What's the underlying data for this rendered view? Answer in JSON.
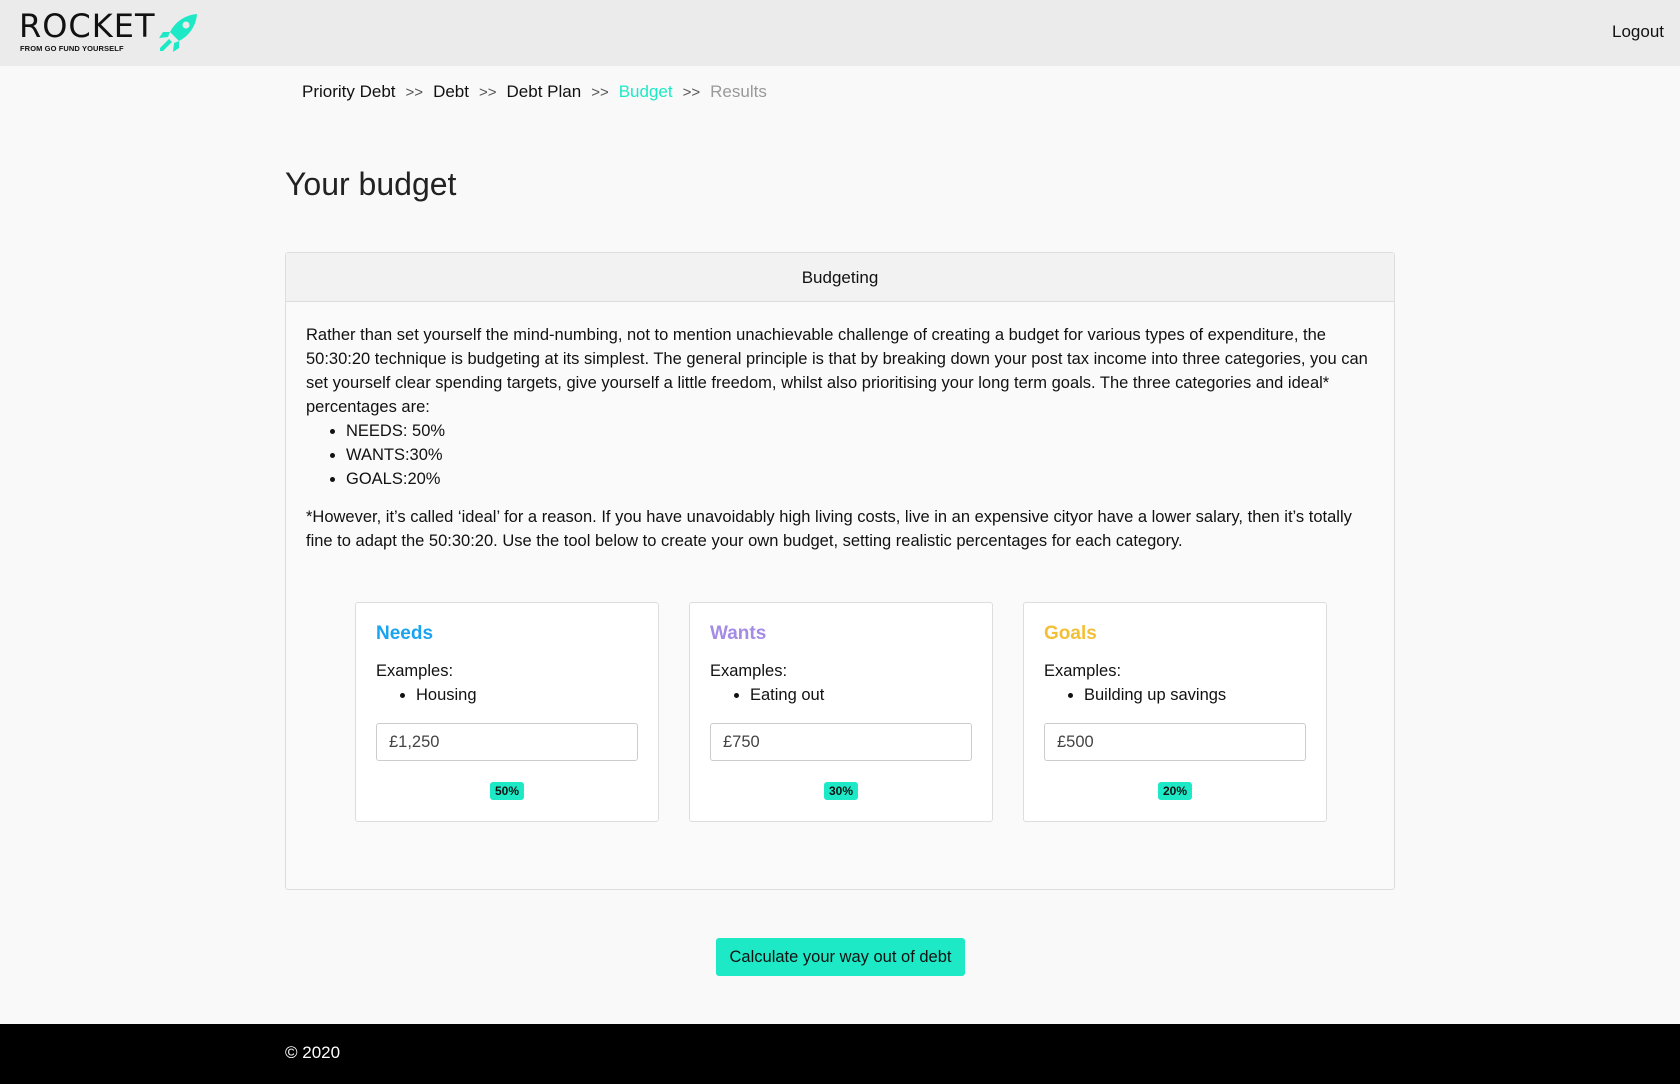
{
  "header": {
    "logo_text": "ROCKET",
    "logo_tagline": "FROM GO FUND YOURSELF",
    "logout_label": "Logout"
  },
  "breadcrumb": {
    "items": [
      {
        "label": "Priority Debt",
        "state": "default"
      },
      {
        "label": "Debt",
        "state": "default"
      },
      {
        "label": "Debt Plan",
        "state": "default"
      },
      {
        "label": "Budget",
        "state": "active"
      },
      {
        "label": "Results",
        "state": "disabled"
      }
    ],
    "separator": ">>"
  },
  "page": {
    "title": "Your budget"
  },
  "budget_card": {
    "header": "Budgeting",
    "intro": "Rather than set yourself the mind-numbing, not to mention unachievable challenge of creating a budget for various types of expenditure, the 50:30:20 technique is budgeting at its simplest. The general principle is that by breaking down your post tax income into three categories, you can set yourself clear spending targets, give yourself a little freedom, whilst also prioritising your long term goals. The three categories and ideal* percentages are:",
    "ideal_list": [
      "NEEDS: 50%",
      "WANTS:30%",
      "GOALS:20%"
    ],
    "note": "*However, it’s called ‘ideal’ for a reason. If you have unavoidably high living costs, live in an expensive cityor have a lower salary, then it’s totally fine to adapt the 50:30:20. Use the tool below to create your own budget, setting realistic percentages for each category."
  },
  "categories": [
    {
      "title": "Needs",
      "examples_label": "Examples:",
      "example": "Housing",
      "value": "£1,250",
      "percent": "50%",
      "color": "#1aa3f0"
    },
    {
      "title": "Wants",
      "examples_label": "Examples:",
      "example": "Eating out",
      "value": "£750",
      "percent": "30%",
      "color": "#a48be6"
    },
    {
      "title": "Goals",
      "examples_label": "Examples:",
      "example": "Building up savings",
      "value": "£500",
      "percent": "20%",
      "color": "#f2c037"
    }
  ],
  "actions": {
    "calculate_label": "Calculate your way out of debt"
  },
  "footer": {
    "copyright": "© 2020"
  },
  "colors": {
    "accent": "#1de9c6",
    "footer_bg": "#000000",
    "header_bg": "#ebebeb"
  }
}
